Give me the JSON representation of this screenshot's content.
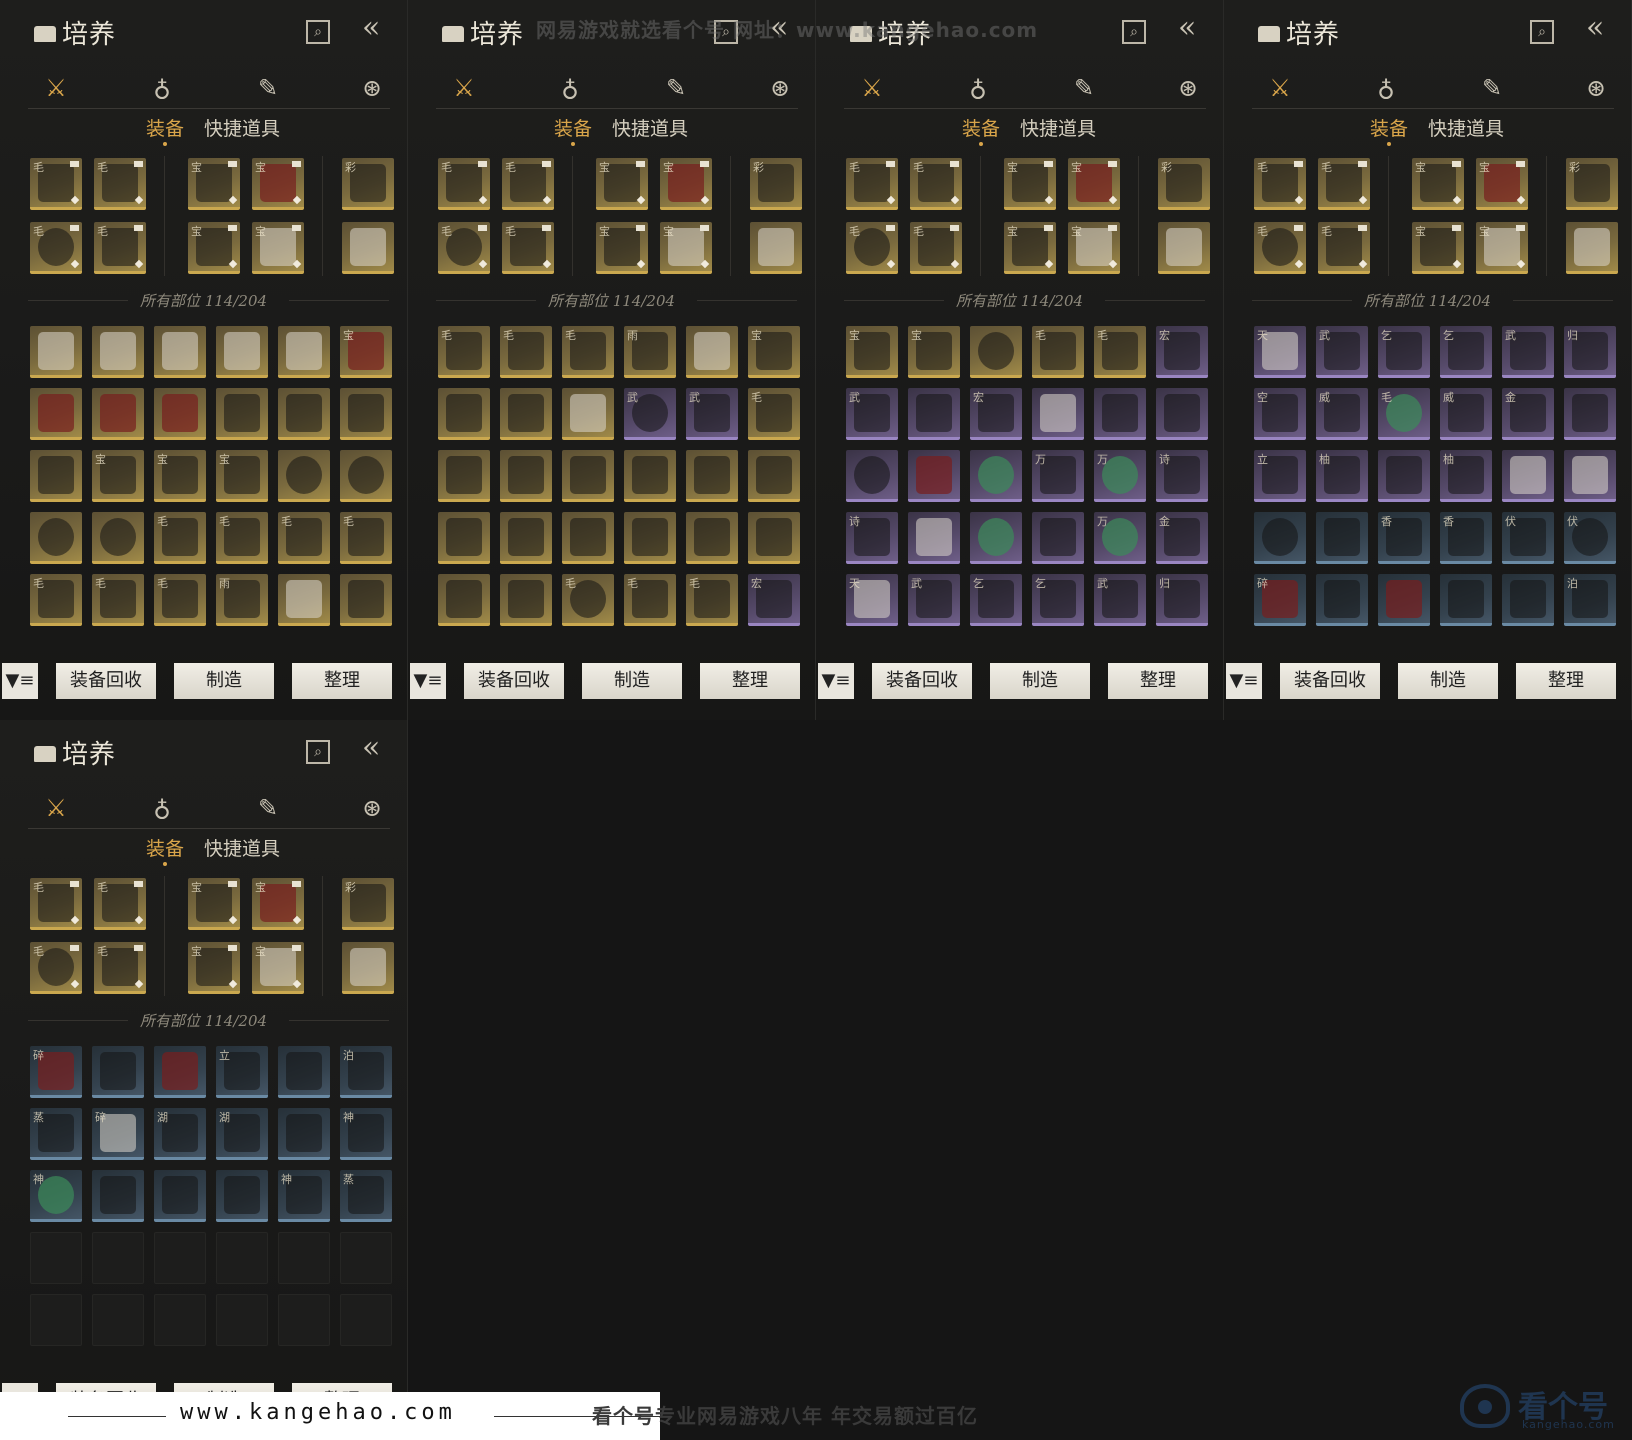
{
  "panel": {
    "title": "培养",
    "search_icon": "search-icon",
    "back_icon": "back-arrows-icon",
    "categories": [
      {
        "name": "weapon-crossed-swords-icon",
        "glyph": "⚔"
      },
      {
        "name": "pouch-icon",
        "glyph": "♁"
      },
      {
        "name": "scroll-icon",
        "glyph": "✎"
      },
      {
        "name": "ornament-icon",
        "glyph": "⊛"
      }
    ],
    "subtabs": {
      "equip": "装备",
      "quick_items": "快捷道具"
    },
    "section_label": "所有部位 114/204",
    "buttons": {
      "filter_icon": "filter-icon",
      "filter_glyph": "▼≡",
      "recycle": "装备回收",
      "craft": "制造",
      "sort": "整理"
    }
  },
  "colors": {
    "accent": "#d9a54a",
    "gold_rarity": "#caa84f",
    "purple_rarity": "#9a86c2",
    "blue_rarity": "#6a8aa4"
  },
  "watermark_top": "网易游戏就选看个号    网址：www.kangehao.com",
  "footer": {
    "url": "www.kangehao.com",
    "slogan": "看个号专业网易游戏八年   年交易额过百亿",
    "logo_text": "看个号",
    "logo_sub": "kangehao.com"
  },
  "equipped": [
    [
      "gold",
      "毛",
      "f",
      1
    ],
    [
      "gold",
      "毛",
      "f",
      1
    ],
    [
      "gold",
      "宝",
      "f",
      1
    ],
    [
      "gold",
      "宝",
      "red",
      1
    ],
    [
      "gold",
      "彩",
      "f",
      0
    ],
    [
      "gold",
      "毛",
      "r",
      1
    ],
    [
      "gold",
      "毛",
      "f",
      1
    ],
    [
      "gold",
      "宝",
      "f",
      1
    ],
    [
      "gold",
      "宝",
      "light",
      1
    ],
    [
      "gold",
      "",
      "light",
      0
    ]
  ],
  "inventories": [
    [
      [
        "gold",
        "",
        "light"
      ],
      [
        "gold",
        "",
        "light"
      ],
      [
        "gold",
        "",
        "light"
      ],
      [
        "gold",
        "",
        "light"
      ],
      [
        "gold",
        "",
        "light"
      ],
      [
        "gold",
        "宝",
        "red"
      ],
      [
        "gold",
        "",
        "red"
      ],
      [
        "gold",
        "",
        "red"
      ],
      [
        "gold",
        "",
        "red"
      ],
      [
        "gold",
        "",
        "f"
      ],
      [
        "gold",
        "",
        "f"
      ],
      [
        "gold",
        "",
        "f"
      ],
      [
        "gold",
        "",
        "f"
      ],
      [
        "gold",
        "宝",
        "f"
      ],
      [
        "gold",
        "宝",
        "f"
      ],
      [
        "gold",
        "宝",
        "f"
      ],
      [
        "gold",
        "",
        "r"
      ],
      [
        "gold",
        "",
        "r"
      ],
      [
        "gold",
        "",
        "r"
      ],
      [
        "gold",
        "",
        "r"
      ],
      [
        "gold",
        "毛",
        "f"
      ],
      [
        "gold",
        "毛",
        "f"
      ],
      [
        "gold",
        "毛",
        "f"
      ],
      [
        "gold",
        "毛",
        "f"
      ],
      [
        "gold",
        "毛",
        "f"
      ],
      [
        "gold",
        "毛",
        "f"
      ],
      [
        "gold",
        "毛",
        "f"
      ],
      [
        "gold",
        "雨",
        "f"
      ],
      [
        "gold",
        "",
        "light"
      ],
      [
        "gold",
        "",
        "f"
      ]
    ],
    [
      [
        "gold",
        "毛",
        "f"
      ],
      [
        "gold",
        "毛",
        "f"
      ],
      [
        "gold",
        "毛",
        "f"
      ],
      [
        "gold",
        "雨",
        "f"
      ],
      [
        "gold",
        "",
        "light"
      ],
      [
        "gold",
        "宝",
        "f"
      ],
      [
        "gold",
        "",
        "f"
      ],
      [
        "gold",
        "",
        "f"
      ],
      [
        "gold",
        "",
        "light"
      ],
      [
        "purple",
        "武",
        "r"
      ],
      [
        "purple",
        "武",
        "f"
      ],
      [
        "gold",
        "毛",
        "f"
      ],
      [
        "gold",
        "",
        "f"
      ],
      [
        "gold",
        "",
        "f"
      ],
      [
        "gold",
        "",
        "f"
      ],
      [
        "gold",
        "",
        "f"
      ],
      [
        "gold",
        "",
        "f"
      ],
      [
        "gold",
        "",
        "f"
      ],
      [
        "gold",
        "",
        "f"
      ],
      [
        "gold",
        "",
        "f"
      ],
      [
        "gold",
        "",
        "f"
      ],
      [
        "gold",
        "",
        "f"
      ],
      [
        "gold",
        "",
        "f"
      ],
      [
        "gold",
        "",
        "f"
      ],
      [
        "gold",
        "",
        "f"
      ],
      [
        "gold",
        "",
        "f"
      ],
      [
        "gold",
        "毛",
        "r"
      ],
      [
        "gold",
        "毛",
        "f"
      ],
      [
        "gold",
        "毛",
        "f"
      ],
      [
        "purple",
        "宏",
        "f"
      ]
    ],
    [
      [
        "gold",
        "宝",
        "f"
      ],
      [
        "gold",
        "宝",
        "f"
      ],
      [
        "gold",
        "",
        "r"
      ],
      [
        "gold",
        "毛",
        "f"
      ],
      [
        "gold",
        "毛",
        "f"
      ],
      [
        "purple",
        "宏",
        "f"
      ],
      [
        "purple",
        "武",
        "f"
      ],
      [
        "purple",
        "",
        "f"
      ],
      [
        "purple",
        "宏",
        "f"
      ],
      [
        "purple",
        "",
        "light"
      ],
      [
        "purple",
        "",
        "f"
      ],
      [
        "purple",
        "",
        "f"
      ],
      [
        "purple",
        "",
        "r"
      ],
      [
        "purple",
        "",
        "red"
      ],
      [
        "purple",
        "",
        "jade"
      ],
      [
        "purple",
        "万",
        "f"
      ],
      [
        "purple",
        "万",
        "jade"
      ],
      [
        "purple",
        "诗",
        "f"
      ],
      [
        "purple",
        "诗",
        "f"
      ],
      [
        "purple",
        "",
        "light"
      ],
      [
        "purple",
        "",
        "jade"
      ],
      [
        "purple",
        "",
        "f"
      ],
      [
        "purple",
        "万",
        "jade"
      ],
      [
        "purple",
        "金",
        "f"
      ],
      [
        "purple",
        "天",
        "light"
      ],
      [
        "purple",
        "武",
        "f"
      ],
      [
        "purple",
        "乞",
        "f"
      ],
      [
        "purple",
        "乞",
        "f"
      ],
      [
        "purple",
        "武",
        "f"
      ],
      [
        "purple",
        "归",
        "f"
      ]
    ],
    [
      [
        "purple",
        "天",
        "light"
      ],
      [
        "purple",
        "武",
        "f"
      ],
      [
        "purple",
        "乞",
        "f"
      ],
      [
        "purple",
        "乞",
        "f"
      ],
      [
        "purple",
        "武",
        "f"
      ],
      [
        "purple",
        "归",
        "f"
      ],
      [
        "purple",
        "空",
        "f"
      ],
      [
        "purple",
        "威",
        "f"
      ],
      [
        "purple",
        "毛",
        "jade"
      ],
      [
        "purple",
        "威",
        "f"
      ],
      [
        "purple",
        "金",
        "f"
      ],
      [
        "purple",
        "",
        "f"
      ],
      [
        "purple",
        "立",
        "f"
      ],
      [
        "purple",
        "柚",
        "f"
      ],
      [
        "purple",
        "",
        "f"
      ],
      [
        "purple",
        "柚",
        "f"
      ],
      [
        "purple",
        "",
        "light"
      ],
      [
        "purple",
        "",
        "light"
      ],
      [
        "blue",
        "",
        "r"
      ],
      [
        "blue",
        "",
        "f"
      ],
      [
        "blue",
        "香",
        "f"
      ],
      [
        "blue",
        "香",
        "f"
      ],
      [
        "blue",
        "伏",
        "f"
      ],
      [
        "blue",
        "伏",
        "r"
      ],
      [
        "blue",
        "碎",
        "red"
      ],
      [
        "blue",
        "",
        "f"
      ],
      [
        "blue",
        "",
        "red"
      ],
      [
        "blue",
        "",
        "f"
      ],
      [
        "blue",
        "",
        "f"
      ],
      [
        "blue",
        "泊",
        "f"
      ]
    ],
    [
      [
        "blue",
        "碎",
        "red"
      ],
      [
        "blue",
        "",
        "f"
      ],
      [
        "blue",
        "",
        "red"
      ],
      [
        "blue",
        "立",
        "f"
      ],
      [
        "blue",
        "",
        "f"
      ],
      [
        "blue",
        "泊",
        "f"
      ],
      [
        "blue",
        "蒸",
        "f"
      ],
      [
        "blue",
        "碎",
        "light"
      ],
      [
        "blue",
        "湖",
        "f"
      ],
      [
        "blue",
        "湖",
        "f"
      ],
      [
        "blue",
        "",
        "f"
      ],
      [
        "blue",
        "神",
        "f"
      ],
      [
        "blue",
        "神",
        "jade"
      ],
      [
        "blue",
        "",
        "f"
      ],
      [
        "blue",
        "",
        "f"
      ],
      [
        "blue",
        "",
        "f"
      ],
      [
        "blue",
        "神",
        "f"
      ],
      [
        "blue",
        "蒸",
        "f"
      ],
      [
        "empty",
        "",
        ""
      ],
      [
        "empty",
        "",
        ""
      ],
      [
        "empty",
        "",
        ""
      ],
      [
        "empty",
        "",
        ""
      ],
      [
        "empty",
        "",
        ""
      ],
      [
        "empty",
        "",
        ""
      ],
      [
        "empty",
        "",
        ""
      ],
      [
        "empty",
        "",
        ""
      ],
      [
        "empty",
        "",
        ""
      ],
      [
        "empty",
        "",
        ""
      ],
      [
        "empty",
        "",
        ""
      ],
      [
        "empty",
        "",
        ""
      ]
    ]
  ]
}
